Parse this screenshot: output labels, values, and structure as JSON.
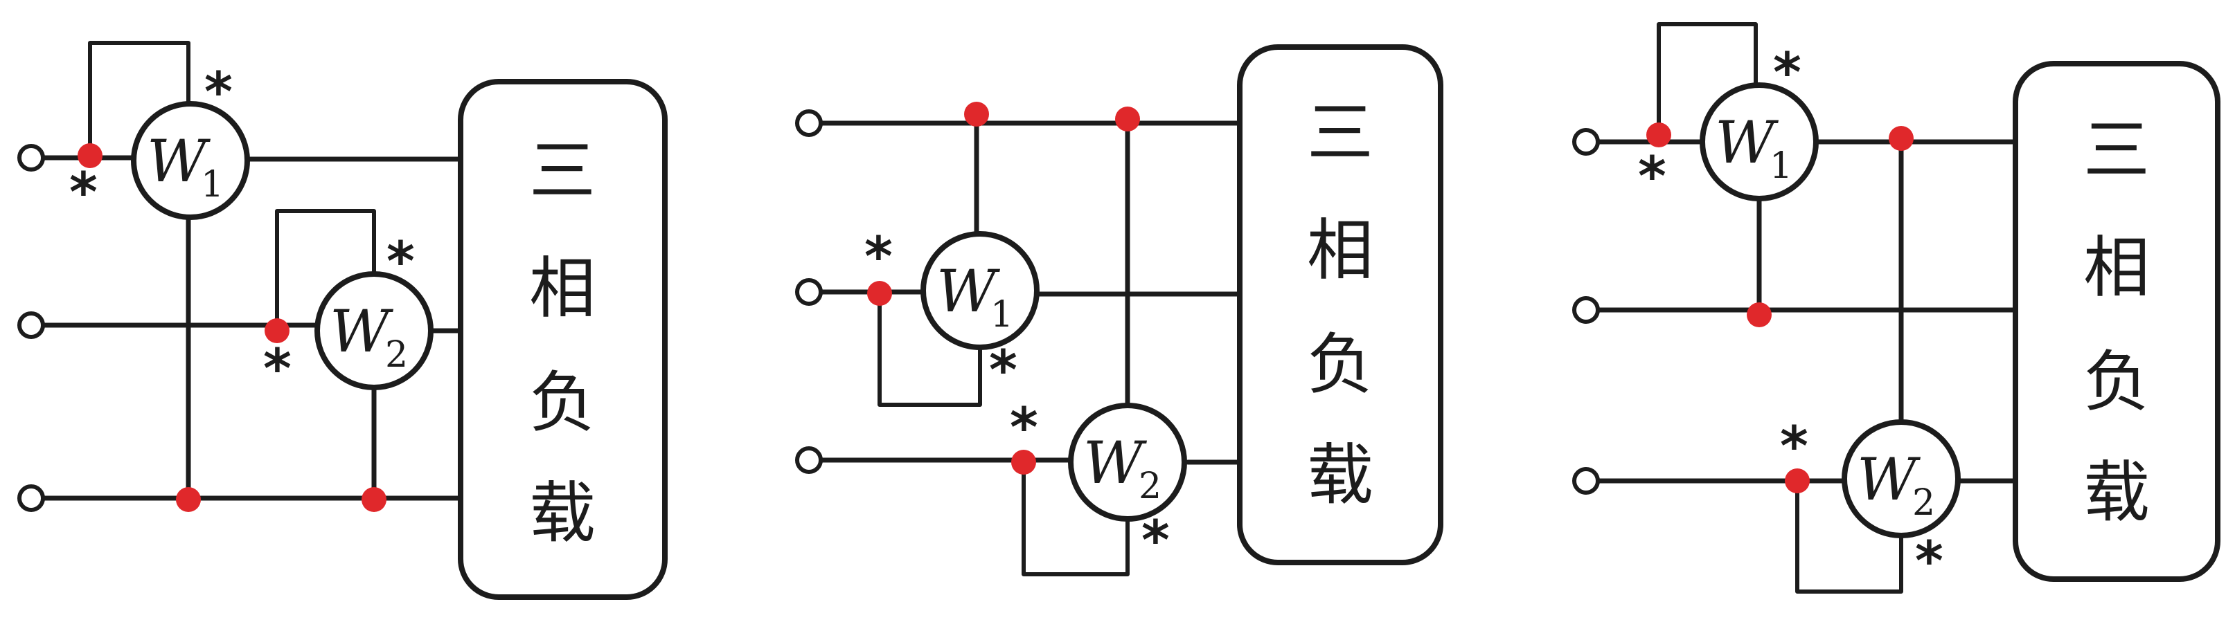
{
  "diagrams": [
    {
      "meters": [
        {
          "letter": "W",
          "sub": "1"
        },
        {
          "letter": "W",
          "sub": "2"
        }
      ],
      "load": [
        "三",
        "相",
        "负",
        "载"
      ],
      "marker": "*"
    },
    {
      "meters": [
        {
          "letter": "W",
          "sub": "1"
        },
        {
          "letter": "W",
          "sub": "2"
        }
      ],
      "load": [
        "三",
        "相",
        "负",
        "载"
      ],
      "marker": "*"
    },
    {
      "meters": [
        {
          "letter": "W",
          "sub": "1"
        },
        {
          "letter": "W",
          "sub": "2"
        }
      ],
      "load": [
        "三",
        "相",
        "负",
        "载"
      ],
      "marker": "*"
    }
  ],
  "colors": {
    "line": "#1c1c1c",
    "node": "#e0282b",
    "background": "#ffffff"
  }
}
